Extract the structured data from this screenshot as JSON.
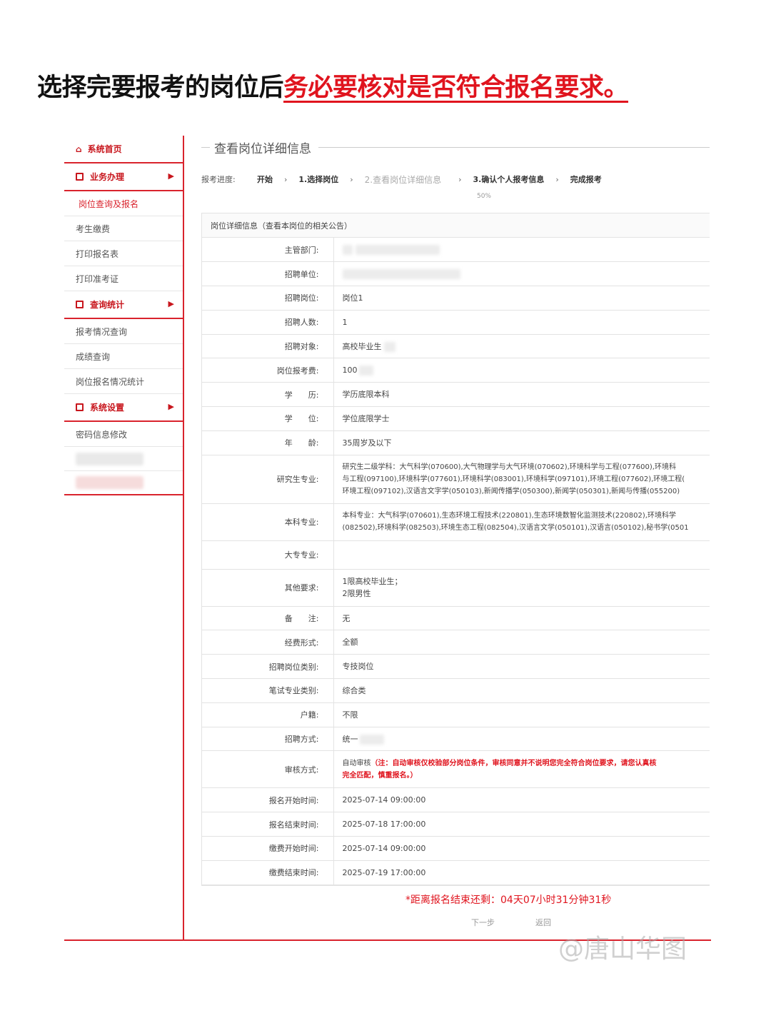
{
  "headline": {
    "part1": "选择完要报考的岗位后",
    "part2": "务必要核对是否符合报名要求。"
  },
  "sidebar": {
    "home": "系统首页",
    "groups": [
      {
        "label": "业务办理",
        "items": [
          "岗位查询及报名",
          "考生缴费",
          "打印报名表",
          "打印准考证"
        ]
      },
      {
        "label": "查询统计",
        "items": [
          "报考情况查询",
          "成绩查询",
          "岗位报名情况统计"
        ]
      },
      {
        "label": "系统设置",
        "items": [
          "密码信息修改"
        ]
      }
    ]
  },
  "main": {
    "title": "查看岗位详细信息",
    "progress": {
      "label": "报考进度:",
      "steps": [
        "开始",
        "1.选择岗位",
        "2.查看岗位详细信息",
        "3.确认个人报考信息",
        "完成报考"
      ],
      "percent": "50%",
      "arrow": "›"
    },
    "panel_title": "岗位详细信息（查看本岗位的相关公告）",
    "rows": [
      {
        "k": "主管部门:",
        "v": ""
      },
      {
        "k": "招聘单位:",
        "v": ""
      },
      {
        "k": "招聘岗位:",
        "v": "岗位1"
      },
      {
        "k": "招聘人数:",
        "v": "1"
      },
      {
        "k": "招聘对象:",
        "v": "高校毕业生"
      },
      {
        "k": "岗位报考费:",
        "v": "100"
      },
      {
        "k": "学　　历:",
        "v": "学历底限本科"
      },
      {
        "k": "学　　位:",
        "v": "学位底限学士"
      },
      {
        "k": "年　　龄:",
        "v": "35周岁及以下"
      },
      {
        "k": "研究生专业:",
        "lines": [
          "研究生二级学科：大气科学(070600),大气物理学与大气环境(070602),环境科学与工程(077600),环境科",
          "与工程(097100),环境科学(077601),环境科学(083001),环境科学(097101),环境工程(077602),环境工程(",
          "环境工程(097102),汉语言文字学(050103),新闻传播学(050300),新闻学(050301),新闻与传播(055200)"
        ]
      },
      {
        "k": "本科专业:",
        "lines": [
          "本科专业：大气科学(070601),生态环境工程技术(220801),生态环境数智化监测技术(220802),环境科学",
          "(082502),环境科学(082503),环境生态工程(082504),汉语言文学(050101),汉语言(050102),秘书学(0501"
        ]
      },
      {
        "k": "大专专业:",
        "v": ""
      },
      {
        "k": "其他要求:",
        "lines": [
          "1限高校毕业生；",
          "2限男性"
        ]
      },
      {
        "k": "备　　注:",
        "v": "无"
      },
      {
        "k": "经费形式:",
        "v": "全额"
      },
      {
        "k": "招聘岗位类别:",
        "v": "专技岗位"
      },
      {
        "k": "笔试专业类别:",
        "v": "综合类"
      },
      {
        "k": "户籍:",
        "v": "不限"
      },
      {
        "k": "招聘方式:",
        "v": "统一"
      },
      {
        "k": "审核方式:",
        "v": "自动审核",
        "note1": "（注：自动审核仅校验部分岗位条件，审核同意并不说明您完全符合岗位要求，请您认真核",
        "note2": "完全匹配，慎重报名。）"
      },
      {
        "k": "报名开始时间:",
        "v": "2025-07-14 09:00:00"
      },
      {
        "k": "报名结束时间:",
        "v": "2025-07-18 17:00:00"
      },
      {
        "k": "缴费开始时间:",
        "v": "2025-07-14 09:00:00"
      },
      {
        "k": "缴费结束时间:",
        "v": "2025-07-19 17:00:00"
      }
    ],
    "countdown": "*距离报名结束还剩：04天07小时31分钟31秒",
    "next_btn": "下一步",
    "back_btn": "返回"
  },
  "watermark": "@唐山华图",
  "colors": {
    "accent": "#d9232d",
    "warning": "#e0141e"
  }
}
